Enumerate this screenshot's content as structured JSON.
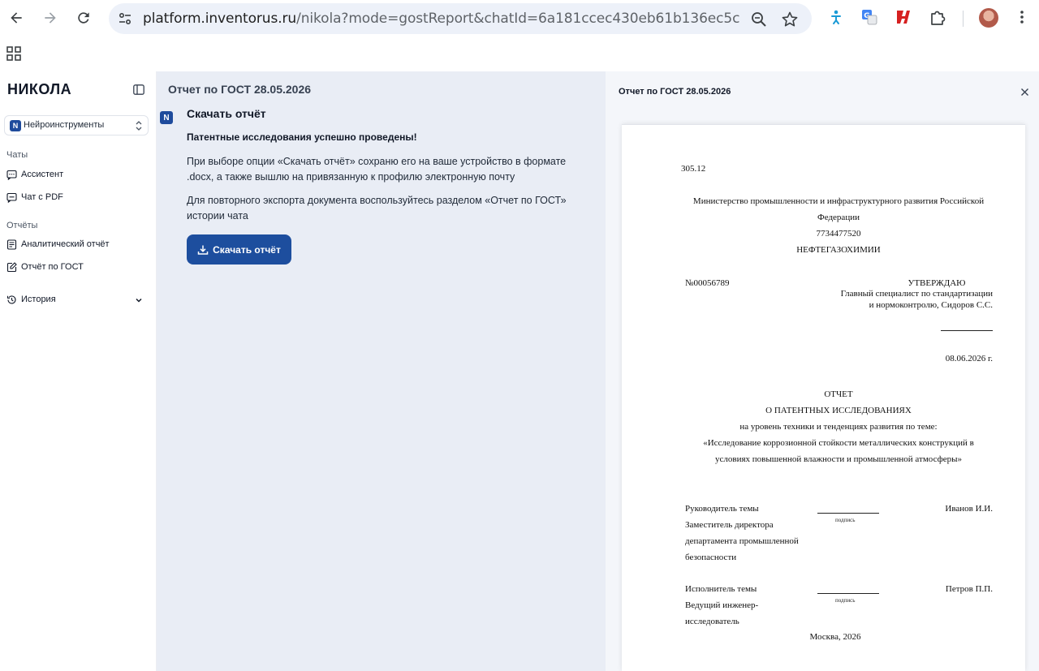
{
  "browser": {
    "url_host": "platform.inventorus.ru",
    "url_path": "/nikola?mode=gostReport&chatId=6a181ccec430eb61b136ec5c"
  },
  "sidebar": {
    "logo": "НИКОЛА",
    "tool_select": {
      "badge": "N",
      "value": "Нейроинструменты"
    },
    "chats_label": "Чаты",
    "chats": [
      {
        "label": "Ассистент",
        "icon": "chat-icon"
      },
      {
        "label": "Чат с PDF",
        "icon": "pdf-chat-icon"
      }
    ],
    "reports_label": "Отчёты",
    "reports": [
      {
        "label": "Аналитический отчёт",
        "icon": "report-icon"
      },
      {
        "label": "Отчёт по ГОСТ",
        "icon": "edit-doc-icon"
      }
    ],
    "history_label": "История"
  },
  "chat": {
    "title": "Отчет по ГОСТ 28.05.2026",
    "avatar": "N",
    "message_title": "Скачать отчёт",
    "message_bold": "Патентные исследования успешно проведены!",
    "message_p1": "При выборе опции «Скачать отчёт» сохраню его на ваше устройство в формате .docx, а также вышлю на привязанную к профилю электронную почту",
    "message_p2": "Для повторного экспорта документа воспользуйтесь разделом «Отчет по ГОСТ» истории чата",
    "download_button": "Скачать отчёт"
  },
  "preview": {
    "title": "Отчет по ГОСТ 28.05.2026",
    "doc": {
      "udk": "305.12",
      "ministry_line1": "Министерство промышленности и инфраструктурного развития Российской",
      "ministry_line2": "Федерации",
      "inn": "7734477520",
      "org": "НЕФТЕГАЗОХИМИИ",
      "number": "№00056789",
      "approve": "УТВЕРЖДАЮ",
      "approver_line1": "Главный специалист по стандартизации",
      "approver_line2": "и нормоконтролю, Сидоров С.С.",
      "date": "08.06.2026 г.",
      "report": "ОТЧЕТ",
      "report_sub1": "О ПАТЕНТНЫХ ИССЛЕДОВАНИЯХ",
      "report_sub2": "на уровень техники и тенденциях развития по теме:",
      "topic_line1": "«Исследование коррозионной стойкости металлических конструкций в",
      "topic_line2": "условиях повышенной влажности и промышленной атмосферы»",
      "lead_role": [
        "Руководитель темы",
        "Заместитель директора",
        "департамента промышленной",
        "безопасности"
      ],
      "lead_name": "Иванов И.И.",
      "signature_caption": "подпись",
      "exec_role": [
        "Исполнитель темы",
        "Ведущий инженер-",
        "исследователь"
      ],
      "exec_name": "Петров П.П.",
      "city_year": "Москва, 2026"
    }
  }
}
